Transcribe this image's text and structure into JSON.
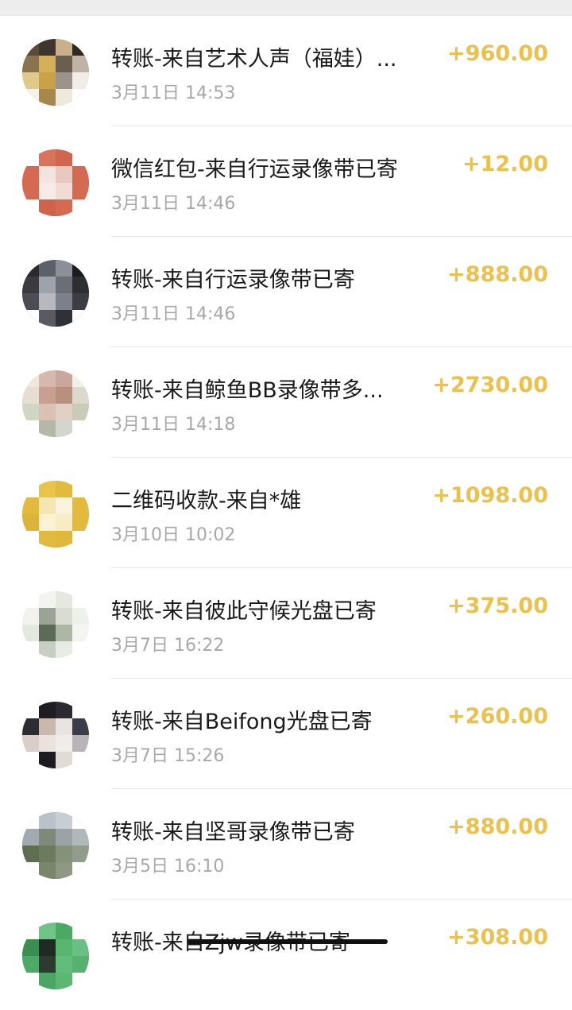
{
  "transactions": [
    {
      "title": "转账-来自艺术人声（福娃）...",
      "time": "3月11日 14:53",
      "amount": "+960.00",
      "avatar": {
        "bg": "#a89466",
        "cells": [
          "#5a4a3c",
          "#3e3530",
          "#c7b08a",
          "#2e2824",
          "#8a7450",
          "#d4b05a",
          "#6a5e4e",
          "#bfb3a6",
          "#e0c98a",
          "#c9a248",
          "#9c948c",
          "#f0ece6",
          "#f5f2ec",
          "#a8884a",
          "#efe9dd",
          "#ffffff"
        ]
      }
    },
    {
      "title": "微信红包-来自行运录像带已寄",
      "time": "3月11日 14:46",
      "amount": "+12.00",
      "avatar": {
        "bg": "#d46a52",
        "cells": [
          "#ffffff",
          "#d9745c",
          "#d06650",
          "#ffffff",
          "#d46a52",
          "#f3e4df",
          "#e9c9bf",
          "#d46a52",
          "#d46a52",
          "#f6ebe7",
          "#f0dcd5",
          "#d46a52",
          "#ffffff",
          "#cf644d",
          "#d46a52",
          "#ffffff"
        ]
      }
    },
    {
      "title": "转账-来自行运录像带已寄",
      "time": "3月11日 14:46",
      "amount": "+888.00",
      "avatar": {
        "bg": "#4a4a52",
        "cells": [
          "#2a2a2e",
          "#5c6068",
          "#8a8f98",
          "#1c1c20",
          "#3a3a40",
          "#9ea3ab",
          "#6a6e76",
          "#2e2f34",
          "#4c4d54",
          "#b6bac0",
          "#7c8088",
          "#3c3d44",
          "#ffffff",
          "#5a5b62",
          "#303136",
          "#ffffff"
        ]
      }
    },
    {
      "title": "转账-来自鲸鱼BB录像带多...",
      "time": "3月11日 14:18",
      "amount": "+2730.00",
      "avatar": {
        "bg": "#d8c8bc",
        "cells": [
          "#efe6dc",
          "#d6b8ac",
          "#c9a79a",
          "#f2efe8",
          "#e8ddd2",
          "#c7a08f",
          "#b8907e",
          "#dcd8cc",
          "#cfd6c4",
          "#d9c2b4",
          "#e0d0c6",
          "#c9ccb8",
          "#ffffff",
          "#b4b9a6",
          "#d2d6cc",
          "#ffffff"
        ]
      }
    },
    {
      "title": "二维码收款-来自*雄",
      "time": "3月10日 10:02",
      "amount": "+1098.00",
      "avatar": {
        "bg": "#e2bb3e",
        "cells": [
          "#ffffff",
          "#e8c44a",
          "#e2bb3e",
          "#ffffff",
          "#e2bb3e",
          "#f4e6b0",
          "#fbf4dc",
          "#e2bb3e",
          "#dcb43a",
          "#fbf2d4",
          "#f7ecc4",
          "#e2bb3e",
          "#ffffff",
          "#e2bb3e",
          "#dfb83c",
          "#ffffff"
        ]
      }
    },
    {
      "title": "转账-来自彼此守候光盘已寄",
      "time": "3月7日 16:22",
      "amount": "+375.00",
      "avatar": {
        "bg": "#eef0ea",
        "cells": [
          "#ffffff",
          "#f3f3ef",
          "#e6e8e0",
          "#ffffff",
          "#f2f2ee",
          "#9aa396",
          "#d8ddd2",
          "#eef0ea",
          "#e4e8de",
          "#5e6a58",
          "#aeb6a6",
          "#f4f5f0",
          "#ffffff",
          "#c8cec2",
          "#e9ece4",
          "#ffffff"
        ]
      }
    },
    {
      "title": "转账-来自Beifong光盘已寄",
      "time": "3月7日 15:26",
      "amount": "+260.00",
      "avatar": {
        "bg": "#e9e3df",
        "cells": [
          "#ffffff",
          "#1e1e22",
          "#2a2a30",
          "#ffffff",
          "#2c2c32",
          "#c8b8ae",
          "#e8e4e2",
          "#3a3e4a",
          "#d9cfc8",
          "#eae2dc",
          "#f0ece8",
          "#b8b4b8",
          "#ffffff",
          "#1c1c20",
          "#e2dad4",
          "#ffffff"
        ]
      }
    },
    {
      "title": "转账-来自坚哥录像带已寄",
      "time": "3月5日 16:10",
      "amount": "+880.00",
      "avatar": {
        "bg": "#8e9a86",
        "cells": [
          "#ffffff",
          "#b8c2c8",
          "#c6cfd4",
          "#ffffff",
          "#a0aab0",
          "#7e8a76",
          "#9aa4a6",
          "#b0b8bc",
          "#5e6e50",
          "#6c7a5e",
          "#84927a",
          "#929c8c",
          "#ffffff",
          "#7a866c",
          "#8e9882",
          "#ffffff"
        ]
      }
    },
    {
      "title": "转账-来自Zjw录像带已寄",
      "time": "",
      "amount": "+308.00",
      "avatar": {
        "bg": "#5ab872",
        "cells": [
          "#ffffff",
          "#6fc488",
          "#4aaa62",
          "#ffffff",
          "#3a8e52",
          "#1e2a22",
          "#58b670",
          "#6ac082",
          "#4ea866",
          "#2c3a30",
          "#62bc7a",
          "#56b26e",
          "#ffffff",
          "#4aa664",
          "#5ab872",
          "#ffffff"
        ]
      }
    }
  ]
}
